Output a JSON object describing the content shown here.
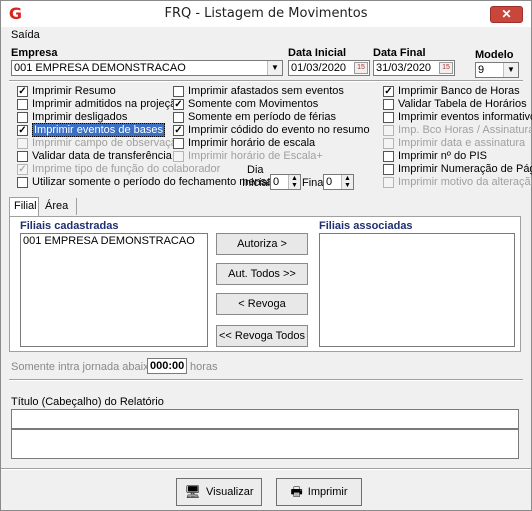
{
  "window": {
    "title": "FRQ - Listagem de Movimentos",
    "app_icon": "G",
    "close_glyph": "✕"
  },
  "menu": {
    "saida": "Saída"
  },
  "empresa": {
    "label": "Empresa",
    "value": "001 EMPRESA DEMONSTRACAO"
  },
  "data_inicial": {
    "label": "Data Inicial",
    "value": "01/03/2020"
  },
  "data_final": {
    "label": "Data Final",
    "value": "31/03/2020"
  },
  "modelo": {
    "label": "Modelo",
    "value": "9"
  },
  "checkboxes": {
    "col1": [
      {
        "label": "Imprimir Resumo",
        "checked": true,
        "disabled": false
      },
      {
        "label": "Imprimir admitidos na projeção",
        "checked": false,
        "disabled": false
      },
      {
        "label": "Imprimir desligados",
        "checked": false,
        "disabled": false
      },
      {
        "label": "Imprimir eventos de bases",
        "checked": true,
        "disabled": false
      },
      {
        "label": "Imprimir campo de observação",
        "checked": false,
        "disabled": true
      },
      {
        "label": "Validar data de transferência",
        "checked": false,
        "disabled": false
      },
      {
        "label": "Imprime tipo de função do colaborador",
        "checked": true,
        "disabled": true
      },
      {
        "label": "Utilizar somente o período do fechamento mensal",
        "checked": false,
        "disabled": false
      }
    ],
    "col2": [
      {
        "label": "Imprimir afastados sem eventos",
        "checked": false,
        "disabled": false
      },
      {
        "label": "Somente com Movimentos",
        "checked": true,
        "disabled": false
      },
      {
        "label": "Somente em período de férias",
        "checked": false,
        "disabled": false
      },
      {
        "label": "Imprimir códido do evento no resumo",
        "checked": true,
        "disabled": false
      },
      {
        "label": "Imprimir horário de escala",
        "checked": false,
        "disabled": false
      },
      {
        "label": "Imprimir horário de Escala+",
        "checked": false,
        "disabled": true
      }
    ],
    "col3": [
      {
        "label": "Imprimir Banco de Horas",
        "checked": true,
        "disabled": false
      },
      {
        "label": "Validar Tabela de Horários",
        "checked": false,
        "disabled": false
      },
      {
        "label": "Imprimir eventos informativos",
        "checked": false,
        "disabled": false
      },
      {
        "label": "Imp. Bco Horas / Assinatura",
        "checked": false,
        "disabled": true
      },
      {
        "label": "Imprimir data e assinatura",
        "checked": false,
        "disabled": true
      },
      {
        "label": "Imprimir nº do PIS",
        "checked": false,
        "disabled": false
      },
      {
        "label": "Imprimir Numeração de Pág.",
        "checked": false,
        "disabled": false
      },
      {
        "label": "Imprimir motivo da alteração",
        "checked": false,
        "disabled": true
      }
    ]
  },
  "dia": {
    "label": "Dia",
    "inicial_label": "Inicial",
    "inicial_value": "0",
    "final_label": "Final",
    "final_value": "0"
  },
  "tabs": [
    {
      "label": "Filial",
      "active": true
    },
    {
      "label": "Área",
      "active": false
    }
  ],
  "filiais": {
    "cadastradas_label": "Filiais cadastradas",
    "associadas_label": "Filiais associadas",
    "cadastradas": [
      "001 EMPRESA DEMONSTRACAO"
    ],
    "associadas": []
  },
  "buttons": {
    "autoriza": "Autoriza >",
    "aut_todos": "Aut. Todos >>",
    "revoga": "< Revoga",
    "revoga_todos": "<< Revoga Todos",
    "visualizar": "Visualizar",
    "imprimir": "Imprimir"
  },
  "intrajornada": {
    "label": "Somente intra jornada abaixo de",
    "value": "000:00",
    "unit": "horas"
  },
  "titulo": {
    "label": "Título (Cabeçalho) do Relatório",
    "value": ""
  },
  "colors": {
    "accent": "#d8241c",
    "selection": "#3a6fc4",
    "close": "#c9463d"
  },
  "icons": {
    "app": "app-logo-icon",
    "close": "close-icon",
    "calendar": "calendar-icon",
    "visualizar": "monitor-icon",
    "imprimir": "printer-icon"
  }
}
